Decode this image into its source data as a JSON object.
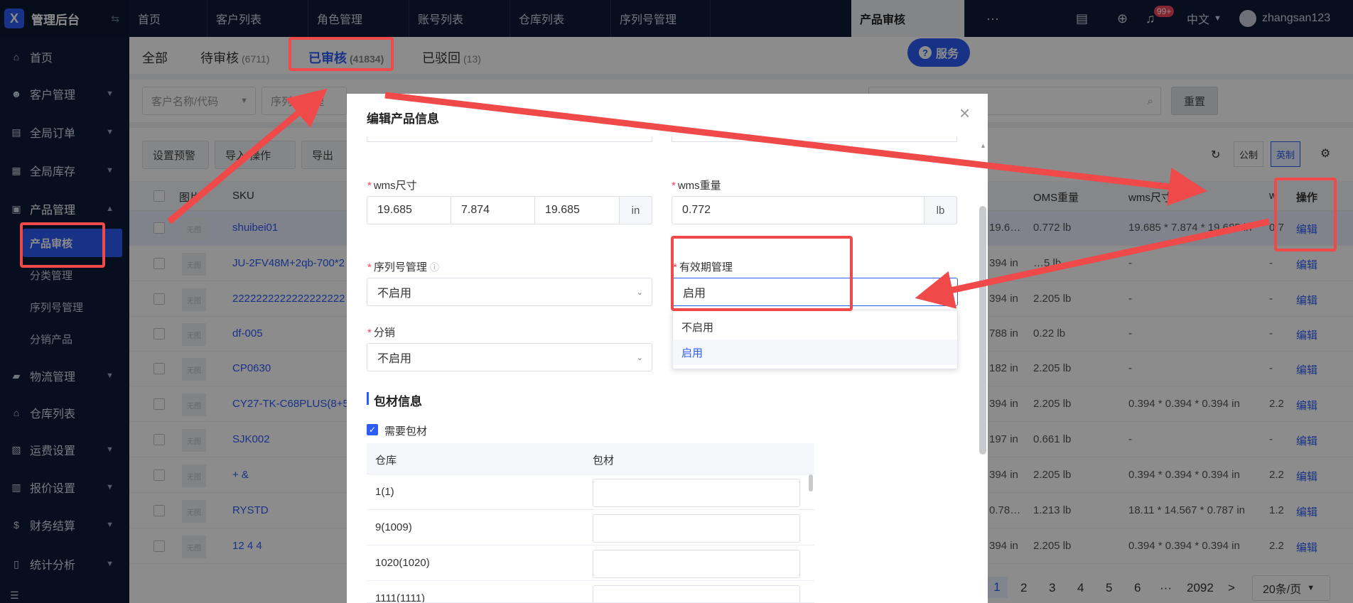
{
  "app": {
    "title": "管理后台",
    "logo_letter": "X"
  },
  "sidebar": {
    "items": [
      {
        "label": "首页",
        "icon": "home-icon",
        "glyph": "⌂"
      },
      {
        "label": "客户管理",
        "icon": "users-icon",
        "glyph": "☻"
      },
      {
        "label": "全局订单",
        "icon": "order-icon",
        "glyph": "▤"
      },
      {
        "label": "全局库存",
        "icon": "inventory-icon",
        "glyph": "▦"
      },
      {
        "label": "产品管理",
        "icon": "product-icon",
        "glyph": "▣"
      },
      {
        "label": "物流管理",
        "icon": "truck-icon",
        "glyph": "▰"
      },
      {
        "label": "仓库列表",
        "icon": "warehouse-icon",
        "glyph": "⌂"
      },
      {
        "label": "运费设置",
        "icon": "freight-icon",
        "glyph": "▧"
      },
      {
        "label": "报价设置",
        "icon": "quote-icon",
        "glyph": "▥"
      },
      {
        "label": "财务结算",
        "icon": "finance-icon",
        "glyph": "$"
      },
      {
        "label": "统计分析",
        "icon": "chart-icon",
        "glyph": "▯"
      }
    ],
    "sub_items": [
      "产品审核",
      "分类管理",
      "序列号管理",
      "分销产品"
    ]
  },
  "topbar": {
    "tabs": [
      "首页",
      "客户列表",
      "角色管理",
      "账号列表",
      "仓库列表",
      "序列号管理",
      "产品审核"
    ],
    "more": "···",
    "notif_badge": "99+",
    "lang": "中文",
    "user": "zhangsan123"
  },
  "status_tabs": [
    {
      "label": "全部",
      "count": ""
    },
    {
      "label": "待审核",
      "count": "(6711)"
    },
    {
      "label": "已审核",
      "count": "(41834)"
    },
    {
      "label": "已驳回",
      "count": "(13)"
    }
  ],
  "service_button": "服务",
  "filters": {
    "customer": "客户名称/代码",
    "serial": "序列号管理",
    "reset": "重置"
  },
  "toolbar": {
    "set_warning": "设置预警",
    "import": "导入/操作",
    "export": "导出",
    "metric": "公制",
    "imperial": "英制"
  },
  "table": {
    "headers": {
      "img": "图片",
      "sku": "SKU",
      "oms_weight": "OMS重量",
      "wms_size": "wms尺寸",
      "wms_w": "w",
      "ops": "操作"
    },
    "edit_label": "编辑",
    "thumb_text": "无图",
    "rows": [
      {
        "sku": "shuibei01",
        "c1": "19.6…",
        "c2": "0.772 lb",
        "c3": "19.685 * 7.874 * 19.685 in",
        "c4": "0.7"
      },
      {
        "sku": "JU-2FV48M+2qb-700*2",
        "c1": "394 in",
        "c2": "…5 lb",
        "c3": "-",
        "c4": "-"
      },
      {
        "sku": "2222222222222222222",
        "c1": "394 in",
        "c2": "2.205 lb",
        "c3": "-",
        "c4": "-"
      },
      {
        "sku": "df-005",
        "c1": "788 in",
        "c2": "0.22 lb",
        "c3": "-",
        "c4": "-"
      },
      {
        "sku": "CP0630",
        "c1": "182 in",
        "c2": "2.205 lb",
        "c3": "-",
        "c4": "-"
      },
      {
        "sku": "CY27-TK-C68PLUS(8+5",
        "c1": "394 in",
        "c2": "2.205 lb",
        "c3": "0.394 * 0.394 * 0.394 in",
        "c4": "2.2"
      },
      {
        "sku": "SJK002",
        "c1": "197 in",
        "c2": "0.661 lb",
        "c3": "-",
        "c4": "-"
      },
      {
        "sku": "+ &",
        "c1": "394 in",
        "c2": "2.205 lb",
        "c3": "0.394 * 0.394 * 0.394 in",
        "c4": "2.2"
      },
      {
        "sku": "RYSTD",
        "c1": "0.78…",
        "c2": "1.213 lb",
        "c3": "18.11 * 14.567 * 0.787 in",
        "c4": "1.2"
      },
      {
        "sku": "12 4 4",
        "c1": "394 in",
        "c2": "2.205 lb",
        "c3": "0.394 * 0.394 * 0.394 in",
        "c4": "2.2"
      }
    ]
  },
  "pagination": {
    "pages": [
      "1",
      "2",
      "3",
      "4",
      "5",
      "6"
    ],
    "ellipsis": "···",
    "last": "2092",
    "next": ">",
    "page_size": "20条/页"
  },
  "modal": {
    "title": "编辑产品信息",
    "close": "×",
    "wms_size_label": "wms尺寸",
    "wms_size": [
      "19.685",
      "7.874",
      "19.685"
    ],
    "size_unit": "in",
    "wms_weight_label": "wms重量",
    "wms_weight": "0.772",
    "weight_unit": "lb",
    "serial_label": "序列号管理",
    "serial_value": "不启用",
    "expiry_label": "有效期管理",
    "expiry_value": "启用",
    "expiry_options": [
      "不启用",
      "启用"
    ],
    "distribution_label": "分销",
    "distribution_value": "不启用",
    "packaging_section": "包材信息",
    "need_packaging": "需要包材",
    "pack_headers": [
      "仓库",
      "包材"
    ],
    "warehouses": [
      "1(1)",
      "9(1009)",
      "1020(1020)",
      "1111(1111)"
    ]
  },
  "colors": {
    "accent": "#2d5cf6",
    "sidebar_bg": "#0d1b35",
    "annotation_red": "#f0494a",
    "required": "#f5455b"
  }
}
